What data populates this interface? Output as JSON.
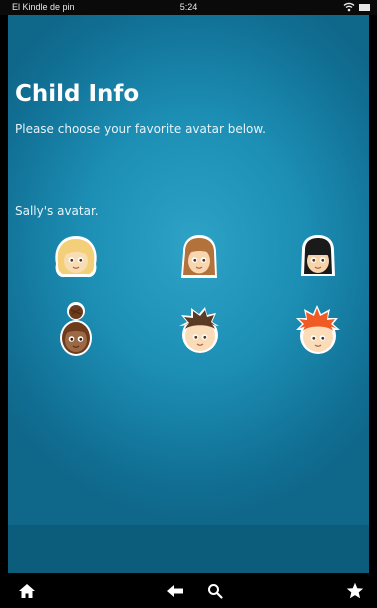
{
  "status_bar": {
    "device_name": "El Kindle de pin",
    "time": "5:24",
    "icons": [
      "wifi-icon",
      "battery-icon"
    ]
  },
  "page": {
    "title": "Child Info",
    "subtitle": "Please choose your favorite avatar below.",
    "avatar_label": "Sally's avatar."
  },
  "avatars": [
    {
      "id": "blonde-bob",
      "hair_color": "#f3cf7a",
      "skin_color": "#f8dcb2"
    },
    {
      "id": "brown-straight",
      "hair_color": "#b3713b",
      "skin_color": "#f8d6b0"
    },
    {
      "id": "black-bangs",
      "hair_color": "#1a1a1a",
      "skin_color": "#f6d3a8"
    },
    {
      "id": "bun-braids",
      "hair_color": "#6e3c1c",
      "skin_color": "#9b6a44"
    },
    {
      "id": "spiky-brown",
      "hair_color": "#5b3b23",
      "skin_color": "#fbdcb8"
    },
    {
      "id": "red-spiky",
      "hair_color": "#f05a24",
      "skin_color": "#fbdcb8"
    }
  ],
  "nav_bar": {
    "icons": [
      "home-icon",
      "back-arrow-icon",
      "search-icon",
      "favorites-star-icon"
    ]
  },
  "colors": {
    "background_center": "#2ea3c6",
    "background_edge": "#0f6789",
    "bottom_strip": "#0c5c7b",
    "nav_bar": "#000000"
  }
}
